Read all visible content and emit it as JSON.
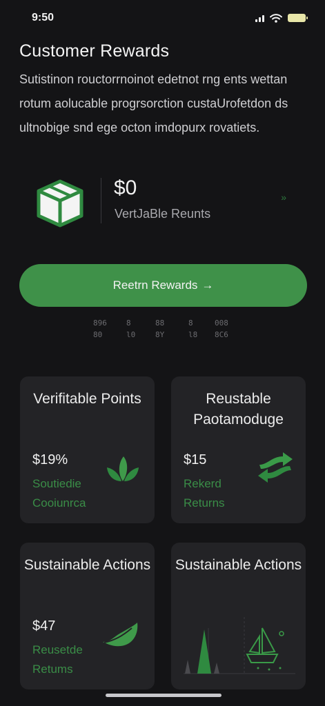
{
  "status_bar": {
    "time": "9:50"
  },
  "header": {
    "title": "Customer Rewards",
    "description": "Sutistinon rouctorrnoinot edetnot rng ents wettan rotum aolucable progrsorction custaUrofetdon ds ultnobige snd ege octon imdopurx rovatiets."
  },
  "balance": {
    "amount": "$0",
    "label": "VertJaBle Reunts",
    "chevron": "»"
  },
  "redeem_button": {
    "label": "Reetrn Rewards",
    "arrow": "→"
  },
  "stats": {
    "row1": [
      "896",
      "8",
      "88",
      "8",
      "008"
    ],
    "row2": [
      "80",
      "l0",
      "8Y",
      "l8",
      "8C6"
    ]
  },
  "cards": [
    {
      "title": "Verifitable Points",
      "value": "$19%",
      "subtitle": "Soutiedie Cooiunrca",
      "icon": "leaf-sprout-icon"
    },
    {
      "title": "Reustable Paotamoduge",
      "value": "$15",
      "subtitle": "Rekerd Returns",
      "icon": "exchange-arrows-icon"
    },
    {
      "title": "Sustainable Actions",
      "value": "$47",
      "subtitle": "Reusetde Retums",
      "icon": "leaf-icon"
    },
    {
      "title": "Sustainable Actions",
      "value": "",
      "subtitle": "",
      "icon": "sailboat-chart-icon"
    }
  ],
  "colors": {
    "background": "#141416",
    "card": "#232326",
    "accent_green": "#3f9149",
    "text_green": "#3a8d47"
  }
}
